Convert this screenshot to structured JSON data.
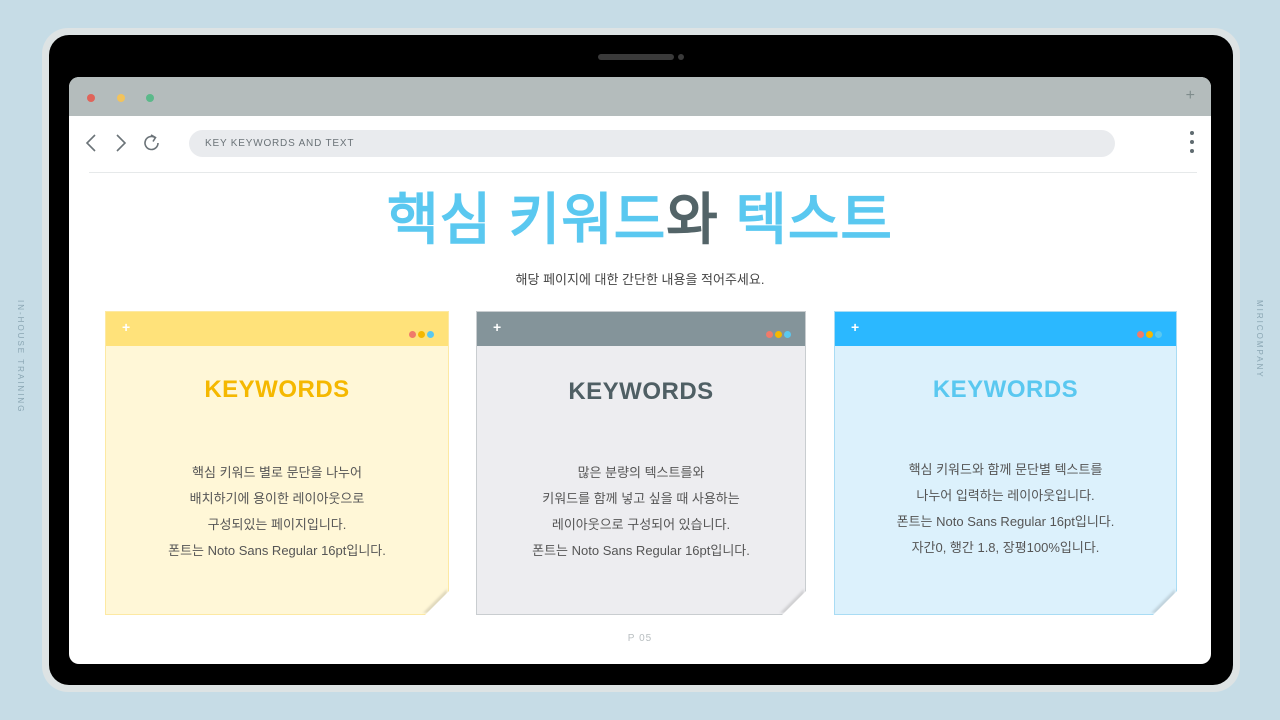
{
  "side_labels": {
    "left": "IN-HOUSE TRAINING",
    "right": "MIRICOMPANY"
  },
  "browser": {
    "traffic_lights": [
      "#e0645a",
      "#f2c35c",
      "#5bb98a"
    ],
    "new_tab_symbol": "+",
    "address": "KEY KEYWORDS AND TEXT",
    "icons": [
      "back-arrow-icon",
      "forward-arrow-icon",
      "refresh-icon",
      "more-vertical-icon"
    ]
  },
  "slide": {
    "title_part1": "핵심 키워드",
    "title_part2": "와",
    "title_part3": "텍스트",
    "subtitle": "해당  페이지에 대한 간단한 내용을 적어주세요.",
    "page_number": "P 05"
  },
  "cards": [
    {
      "header_color": "#ffe27a",
      "bg_color": "#fff7d7",
      "border_color": "#fde9a3",
      "title_color": "#f5b800",
      "plus": "+",
      "title": "KEYWORDS",
      "lines": [
        "핵심 키워드 별로 문단을 나누어",
        "배치하기에 용이한 레이아웃으로",
        "구성되있는 페이지입니다.",
        "폰트는 Noto Sans Regular 16pt입니다."
      ]
    },
    {
      "header_color": "#84949a",
      "bg_color": "#ededf0",
      "border_color": "#c9cdd0",
      "title_color": "#4f5f64",
      "plus": "+",
      "title": "KEYWORDS",
      "lines": [
        "많은 분량의 텍스트를와",
        "키워드를 함께 넣고 싶을 때 사용하는",
        "레이아웃으로 구성되어 있습니다.",
        "폰트는 Noto Sans Regular 16pt입니다."
      ]
    },
    {
      "header_color": "#2bb8ff",
      "bg_color": "#dcf1fc",
      "border_color": "#a9dcf4",
      "title_color": "#5ac8f0",
      "plus": "+",
      "title": "KEYWORDS",
      "lines": [
        "핵심 키워드와 함께 문단별 텍스트를",
        "나누어 입력하는 레이아웃입니다.",
        "폰트는 Noto Sans Regular 16pt입니다.",
        "자간0, 행간 1.8, 장평100%입니다."
      ]
    }
  ],
  "card_dot_colors": [
    "#f07a6a",
    "#f5b800",
    "#5ac8f0"
  ]
}
